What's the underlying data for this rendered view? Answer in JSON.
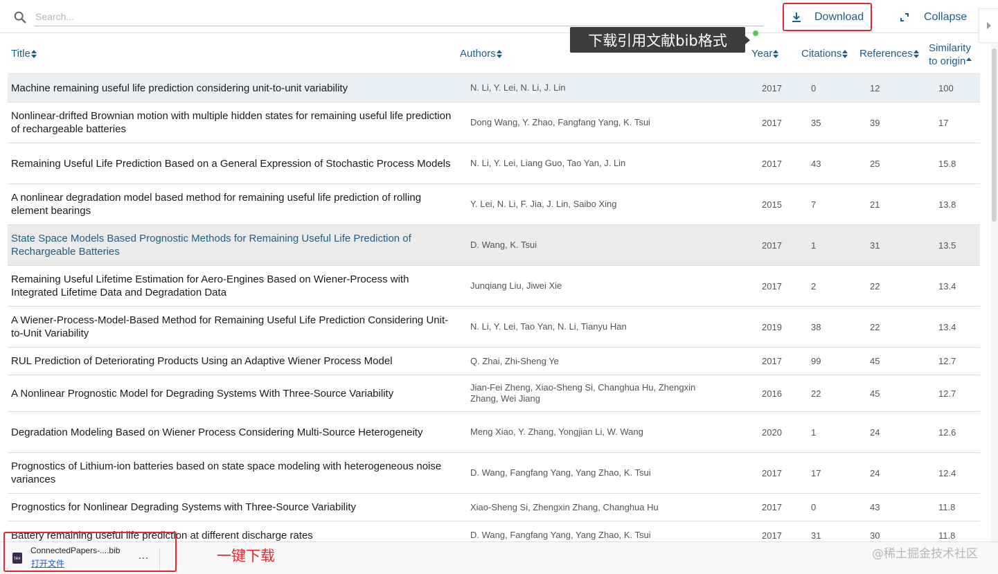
{
  "search": {
    "placeholder": "Search..."
  },
  "toolbar": {
    "download_label": "Download",
    "collapse_label": "Collapse",
    "download_tooltip": "下载引用文献bib格式"
  },
  "columns": {
    "title": "Title",
    "authors": "Authors",
    "year": "Year",
    "citations": "Citations",
    "references": "References",
    "similarity_line1": "Similarity",
    "similarity_line2": "to origin"
  },
  "rows": [
    {
      "title": "Machine remaining useful life prediction considering unit-to-unit variability",
      "authors": "N. Li, Y. Lei, N. Li, J. Lin",
      "year": "2017",
      "citations": "0",
      "references": "12",
      "similarity": "100"
    },
    {
      "title": "Nonlinear-drifted Brownian motion with multiple hidden states for remaining useful life prediction of rechargeable batteries",
      "authors": "Dong Wang, Y. Zhao, Fangfang Yang, K. Tsui",
      "year": "2017",
      "citations": "35",
      "references": "39",
      "similarity": "17"
    },
    {
      "title": "Remaining Useful Life Prediction Based on a General Expression of Stochastic Process Models",
      "authors": "N. Li, Y. Lei, Liang Guo, Tao Yan, J. Lin",
      "year": "2017",
      "citations": "43",
      "references": "25",
      "similarity": "15.8"
    },
    {
      "title": "A nonlinear degradation model based method for remaining useful life prediction of rolling element bearings",
      "authors": "Y. Lei, N. Li, F. Jia, J. Lin, Saibo Xing",
      "year": "2015",
      "citations": "7",
      "references": "21",
      "similarity": "13.8"
    },
    {
      "title": "State Space Models Based Prognostic Methods for Remaining Useful Life Prediction of Rechargeable Batteries",
      "authors": "D. Wang, K. Tsui",
      "year": "2017",
      "citations": "1",
      "references": "31",
      "similarity": "13.5"
    },
    {
      "title": "Remaining Useful Lifetime Estimation for Aero-Engines Based on Wiener-Process with Integrated Lifetime Data and Degradation Data",
      "authors": "Junqiang Liu, Jiwei Xie",
      "year": "2017",
      "citations": "2",
      "references": "22",
      "similarity": "13.4"
    },
    {
      "title": "A Wiener-Process-Model-Based Method for Remaining Useful Life Prediction Considering Unit-to-Unit Variability",
      "authors": "N. Li, Y. Lei, Tao Yan, N. Li, Tianyu Han",
      "year": "2019",
      "citations": "38",
      "references": "22",
      "similarity": "13.4"
    },
    {
      "title": "RUL Prediction of Deteriorating Products Using an Adaptive Wiener Process Model",
      "authors": "Q. Zhai, Zhi-Sheng Ye",
      "year": "2017",
      "citations": "99",
      "references": "45",
      "similarity": "12.7"
    },
    {
      "title": "A Nonlinear Prognostic Model for Degrading Systems With Three-Source Variability",
      "authors": "Jian-Fei Zheng, Xiao-Sheng Si, Changhua Hu, Zhengxin Zhang, Wei Jiang",
      "year": "2016",
      "citations": "22",
      "references": "45",
      "similarity": "12.7"
    },
    {
      "title": "Degradation Modeling Based on Wiener Process Considering Multi-Source Heterogeneity",
      "authors": "Meng Xiao, Y. Zhang, Yongjian Li, W. Wang",
      "year": "2020",
      "citations": "1",
      "references": "24",
      "similarity": "12.6"
    },
    {
      "title": "Prognostics of Lithium-ion batteries based on state space modeling with heterogeneous noise variances",
      "authors": "D. Wang, Fangfang Yang, Yang Zhao, K. Tsui",
      "year": "2017",
      "citations": "17",
      "references": "24",
      "similarity": "12.4"
    },
    {
      "title": "Prognostics for Nonlinear Degrading Systems with Three-Source Variability",
      "authors": "Xiao-Sheng Si, Zhengxin Zhang, Changhua Hu",
      "year": "2017",
      "citations": "0",
      "references": "43",
      "similarity": "11.8"
    },
    {
      "title": "Battery remaining useful life prediction at different discharge rates",
      "authors": "D. Wang, Fangfang Yang, Yang Zhao, K. Tsui",
      "year": "2017",
      "citations": "31",
      "references": "30",
      "similarity": "11.8"
    }
  ],
  "download_shelf": {
    "file_name": "ConnectedPapers-....bib",
    "open_label": "打开文件",
    "more_label": "…",
    "annotation": "一键下载"
  },
  "watermark": "@稀土掘金技术社区",
  "colors": {
    "link": "#1e5f86",
    "highlight_box": "#e8262d",
    "selected_row": "#e9f1f6",
    "hover_row": "#ebebeb"
  }
}
